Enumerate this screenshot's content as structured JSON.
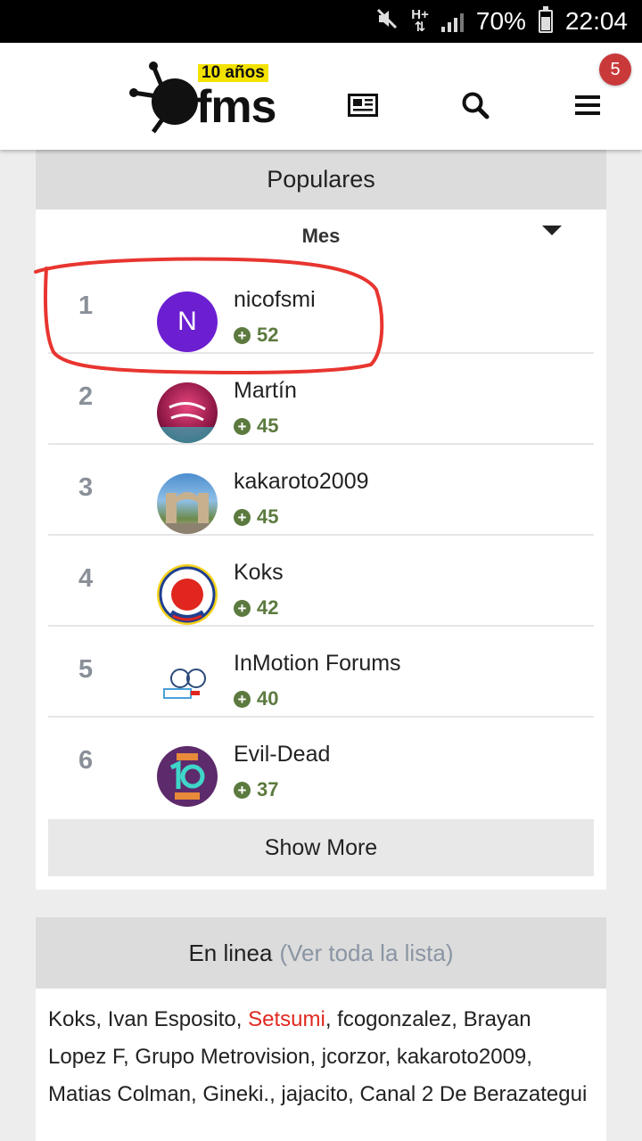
{
  "status_bar": {
    "battery": "70%",
    "time": "22:04",
    "network": "H+",
    "battery_level": 0.7,
    "icons": [
      "mute-icon",
      "network-hplus-icon",
      "signal-icon",
      "battery-icon"
    ]
  },
  "header": {
    "logo_badge": "10 años",
    "logo_text": "fms",
    "notification_count": "5",
    "icons": [
      "news-icon",
      "search-icon",
      "menu-icon"
    ]
  },
  "popular": {
    "title": "Populares",
    "filter": "Mes",
    "users": [
      {
        "rank": "1",
        "name": "nicofsmi",
        "points": "52",
        "initial": "N"
      },
      {
        "rank": "2",
        "name": "Martín",
        "points": "45"
      },
      {
        "rank": "3",
        "name": "kakaroto2009",
        "points": "45"
      },
      {
        "rank": "4",
        "name": "Koks",
        "points": "42"
      },
      {
        "rank": "5",
        "name": "InMotion Forums",
        "points": "40"
      },
      {
        "rank": "6",
        "name": "Evil-Dead",
        "points": "37"
      }
    ],
    "show_more": "Show More"
  },
  "online": {
    "title": "En linea",
    "view_all": "(Ver toda la lista)",
    "names_before": "Koks, Ivan Esposito, ",
    "highlighted": "Setsumi",
    "names_after": ", fcogonzalez, Brayan Lopez F, Grupo Metrovision, jcorzor, kakaroto2009, Matias Colman, Gineki., jajacito, Canal 2 De Berazategui"
  },
  "colors": {
    "accent_red": "#c9393a",
    "points_green": "#5c7a3f",
    "highlight_user": "#e02a20",
    "avatar_purple": "#6c1fd1"
  }
}
